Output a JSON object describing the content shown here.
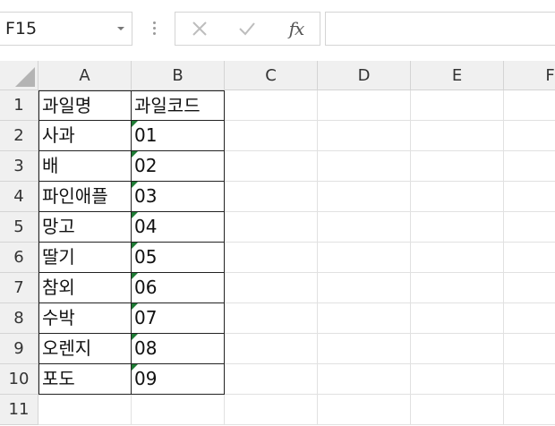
{
  "name_box": {
    "value": "F15"
  },
  "formula_bar": {
    "cancel_icon": "close-icon",
    "enter_icon": "check-icon",
    "fx_label": "fx",
    "formula": ""
  },
  "columns": [
    "A",
    "B",
    "C",
    "D",
    "E",
    "F"
  ],
  "rows": [
    "1",
    "2",
    "3",
    "4",
    "5",
    "6",
    "7",
    "8",
    "9",
    "10",
    "11"
  ],
  "table": {
    "headers": [
      "과일명",
      "과일코드"
    ],
    "rows": [
      [
        "사과",
        "01"
      ],
      [
        "배",
        "02"
      ],
      [
        "파인애플",
        "03"
      ],
      [
        "망고",
        "04"
      ],
      [
        "딸기",
        "05"
      ],
      [
        "참외",
        "06"
      ],
      [
        "수박",
        "07"
      ],
      [
        "오렌지",
        "08"
      ],
      [
        "포도",
        "09"
      ]
    ]
  },
  "colors": {
    "header_bg": "#f0f0f0",
    "gridline": "#e1e1e1",
    "error_indicator": "#1e7b34"
  }
}
